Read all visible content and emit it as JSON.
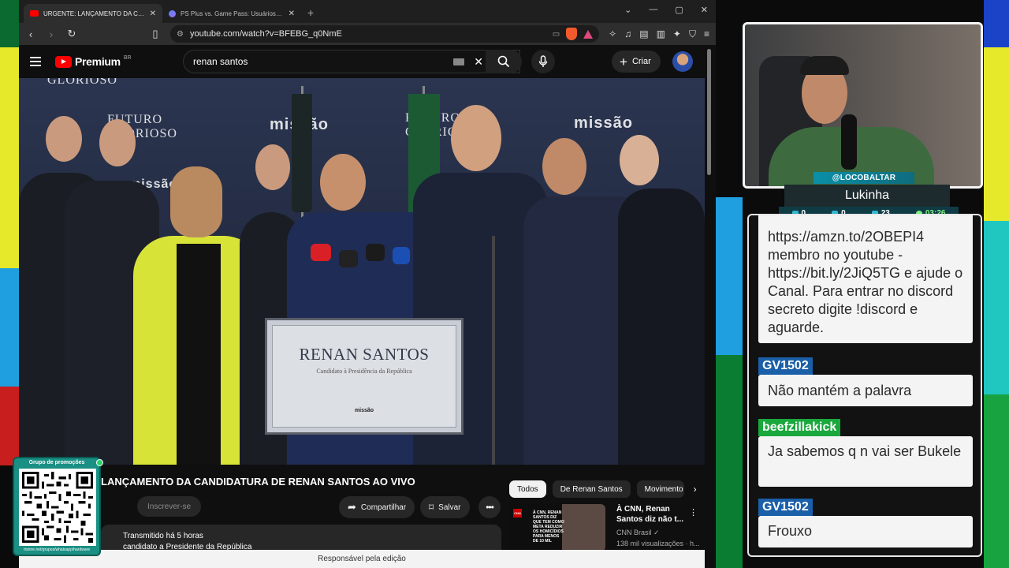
{
  "browser": {
    "tabs": [
      {
        "title": "URGENTE: LANÇAMENTO DA CAND",
        "active": true
      },
      {
        "title": "PS Plus vs. Game Pass: Usuários Ativos - Goo",
        "active": false
      }
    ],
    "url": "youtube.com/watch?v=BFEBG_q0NmE"
  },
  "youtube": {
    "brand": "Premium",
    "country": "BR",
    "search_value": "renan santos",
    "create_label": "Criar"
  },
  "video": {
    "podium_name": "RENAN SANTOS",
    "podium_subtitle": "Candidato à Presidência da República",
    "podium_brand": "missão",
    "backdrop_words": [
      "GLORIOSO",
      "FUTURO GLORIOSO",
      "missão",
      "FUTURO GLORIOSO",
      "missão",
      "missão"
    ],
    "title": "LANÇAMENTO DA CANDIDATURA DE RENAN SANTOS AO VIVO",
    "subscribe_label": "Inscrever-se",
    "share_label": "Compartilhar",
    "save_label": "Salvar",
    "desc_line1": "Transmitido há 5 horas",
    "desc_line2": "candidato a Presidente da República"
  },
  "recommendations": {
    "chips": [
      "Todos",
      "De Renan Santos",
      "Movimento"
    ],
    "item": {
      "title": "À CNN, Renan Santos diz não t...",
      "channel": "CNN Brasil",
      "views": "138 mil visualizações · h...",
      "thumb_text": "À CNN, RENAN SANTOS DIZ QUE TEM COMO META REDUZIR OS HOMICÍDIOS PARA MENOS DE 10 MIL",
      "thumb_logo": "CNN"
    }
  },
  "statusbar": "Responsável pela edição",
  "streamer": {
    "handle": "@LOCOBALTAR",
    "name": "Lukinha",
    "stats": [
      "0",
      "0",
      "23",
      "03:26"
    ]
  },
  "chat": [
    {
      "user": "",
      "text": "https://amzn.to/2OBEPI4 membro no youtube - https://bit.ly/2JiQ5TG e ajude o Canal. Para entrar no discord secreto digite !discord e aguarde."
    },
    {
      "user": "GV1502",
      "text": "Não mantém a palavra",
      "color": "#1b5fa8"
    },
    {
      "user": "beefzillakick",
      "text": "Ja sabemos q n vai ser Bukele",
      "color": "#1aa83c"
    },
    {
      "user": "GV1502",
      "text": "Frouxo",
      "color": "#1b5fa8"
    }
  ],
  "qr": {
    "title": "Grupo de promoções",
    "url": "rtstore.net/grupos/whatsapp/hardware"
  },
  "colors": {
    "youtube_red": "#ff0000",
    "accent_teal": "#0b8fa8",
    "chat_blue": "#1b5fa8",
    "chat_green": "#1aa83c"
  }
}
